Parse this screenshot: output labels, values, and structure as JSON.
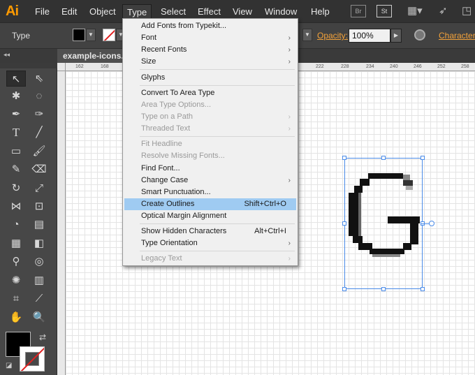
{
  "app": {
    "logo": "Ai"
  },
  "menubar": {
    "items": [
      "File",
      "Edit",
      "Object",
      "Type",
      "Select",
      "Effect",
      "View",
      "Window",
      "Help"
    ],
    "bridge_label": "Br",
    "stock_label": "St"
  },
  "controlbar": {
    "tool_label": "Type",
    "opacity_label": "Opacity:",
    "opacity_value": "100%",
    "character_label": "Character:"
  },
  "document": {
    "tab_title": "example-icons.ai"
  },
  "ruler": {
    "ticks": [
      "162",
      "168",
      "222",
      "228",
      "234",
      "240",
      "246",
      "252",
      "258"
    ]
  },
  "type_menu": {
    "items": [
      {
        "label": "Add Fonts from Typekit...",
        "enabled": true
      },
      {
        "label": "Font",
        "enabled": true,
        "submenu": true
      },
      {
        "label": "Recent Fonts",
        "enabled": true,
        "submenu": true
      },
      {
        "label": "Size",
        "enabled": true,
        "submenu": true
      },
      {
        "label": "Glyphs",
        "enabled": true
      },
      {
        "label": "Convert To Area Type",
        "enabled": true
      },
      {
        "label": "Area Type Options...",
        "enabled": false
      },
      {
        "label": "Type on a Path",
        "enabled": false,
        "submenu": true
      },
      {
        "label": "Threaded Text",
        "enabled": false,
        "submenu": true
      },
      {
        "label": "Fit Headline",
        "enabled": false
      },
      {
        "label": "Resolve Missing Fonts...",
        "enabled": false
      },
      {
        "label": "Find Font...",
        "enabled": true
      },
      {
        "label": "Change Case",
        "enabled": true,
        "submenu": true
      },
      {
        "label": "Smart Punctuation...",
        "enabled": true
      },
      {
        "label": "Create Outlines",
        "enabled": true,
        "shortcut": "Shift+Ctrl+O",
        "highlighted": true
      },
      {
        "label": "Optical Margin Alignment",
        "enabled": true
      },
      {
        "label": "Show Hidden Characters",
        "enabled": true,
        "shortcut": "Alt+Ctrl+I"
      },
      {
        "label": "Type Orientation",
        "enabled": true,
        "submenu": true
      },
      {
        "label": "Legacy Text",
        "enabled": false,
        "submenu": true
      }
    ]
  },
  "artwork": {
    "glyph": "G"
  },
  "colors": {
    "accent_orange": "#f3a23a",
    "menu_highlight": "#9fcbf2",
    "selection_blue": "#4a8be8",
    "logo_orange": "#ff9a00"
  }
}
